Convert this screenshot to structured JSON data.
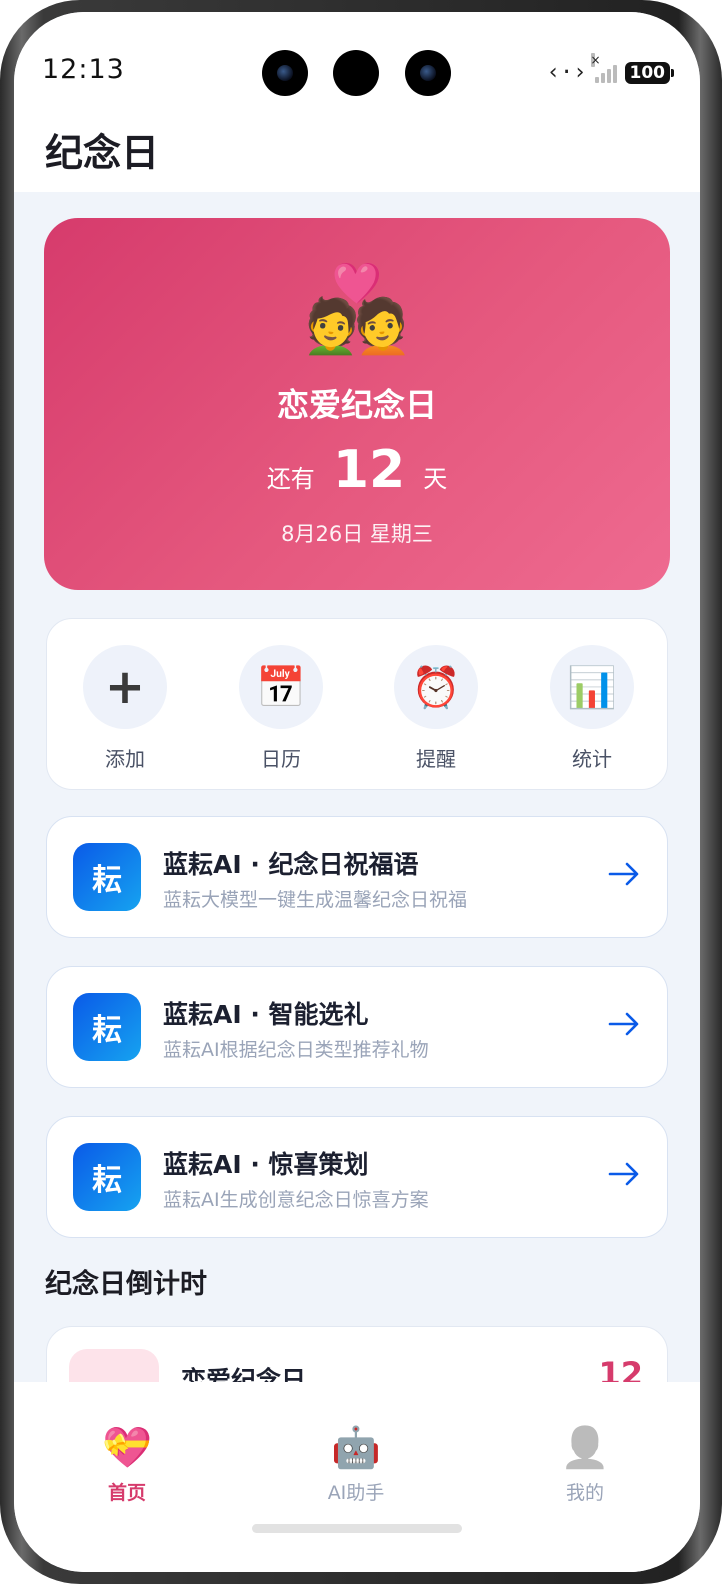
{
  "status_bar": {
    "time": "12:13",
    "battery": "100"
  },
  "header": {
    "title": "纪念日"
  },
  "hero": {
    "emoji": "💑",
    "title": "恋爱纪念日",
    "prefix": "还有",
    "days": "12",
    "suffix": "天",
    "date": "8月26日 星期三"
  },
  "quick_actions": [
    {
      "label": "添加",
      "icon": "plus-icon",
      "glyph": "+"
    },
    {
      "label": "日历",
      "icon": "calendar-icon",
      "glyph": "📅"
    },
    {
      "label": "提醒",
      "icon": "alarm-clock-icon",
      "glyph": "⏰"
    },
    {
      "label": "统计",
      "icon": "bar-chart-icon",
      "glyph": "📊"
    }
  ],
  "ai_cards": [
    {
      "logo": "耘",
      "title": "蓝耘AI · 纪念日祝福语",
      "subtitle": "蓝耘大模型一键生成温馨纪念日祝福"
    },
    {
      "logo": "耘",
      "title": "蓝耘AI · 智能选礼",
      "subtitle": "蓝耘AI根据纪念日类型推荐礼物"
    },
    {
      "logo": "耘",
      "title": "蓝耘AI · 惊喜策划",
      "subtitle": "蓝耘AI生成创意纪念日惊喜方案"
    }
  ],
  "section": {
    "title": "纪念日倒计时"
  },
  "countdown_list": [
    {
      "emoji": "💝",
      "name": "恋爱纪念日",
      "days": "12"
    }
  ],
  "tabs": [
    {
      "label": "首页",
      "icon": "gift-heart-icon",
      "glyph": "💝",
      "active": true
    },
    {
      "label": "AI助手",
      "icon": "robot-icon",
      "glyph": "🤖",
      "active": false
    },
    {
      "label": "我的",
      "icon": "user-silhouette-icon",
      "glyph": "👤",
      "active": false
    }
  ],
  "colors": {
    "accent": "#d63b6c",
    "ai_blue": "#0a5ae8",
    "background": "#f0f4fa"
  }
}
